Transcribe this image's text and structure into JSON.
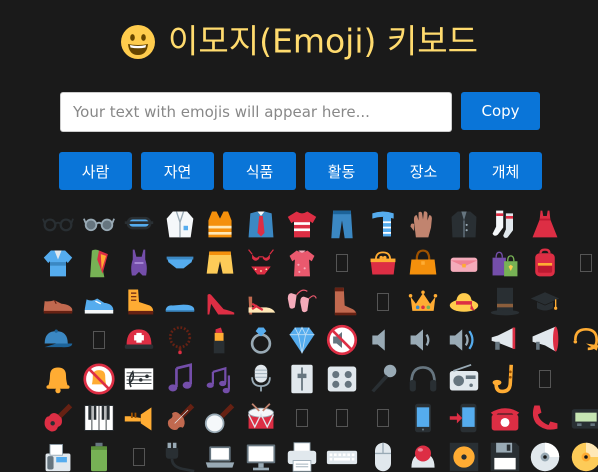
{
  "header": {
    "title": "이모지(Emoji) 키보드",
    "title_icon": "grinning-face-icon"
  },
  "input": {
    "placeholder": "Your text with emojis will appear here...",
    "value": ""
  },
  "copy_button": {
    "label": "Copy"
  },
  "categories": [
    {
      "label": "사람"
    },
    {
      "label": "자연"
    },
    {
      "label": "식품"
    },
    {
      "label": "활동"
    },
    {
      "label": "장소"
    },
    {
      "label": "개체"
    }
  ],
  "colors": {
    "background": "#1a1a1a",
    "title": "#ffdb6e",
    "button": "#0a75d8",
    "button_text": "#ffffff"
  },
  "emoji_rows": [
    [
      "glasses-icon",
      "sunglasses-icon",
      "goggles-icon",
      "lab-coat-icon",
      "safety-vest-icon",
      "necktie-icon",
      "t-shirt-icon",
      "jeans-icon",
      "scarf-icon",
      "gloves-icon",
      "coat-icon",
      "socks-icon",
      "dress-icon"
    ],
    [
      "kimono-icon",
      "sari-icon",
      "one-piece-swimsuit-icon",
      "briefs-icon",
      "shorts-icon",
      "bikini-icon",
      "womans-clothes-icon",
      "missing-glyph",
      "purse-icon",
      "handbag-icon",
      "clutch-bag-icon",
      "shopping-bags-icon",
      "backpack-icon",
      "missing-glyph"
    ],
    [
      "mans-shoe-icon",
      "running-shoe-icon",
      "hiking-boot-icon",
      "flat-shoe-icon",
      "high-heel-icon",
      "sandal-icon",
      "ballet-shoes-icon",
      "womans-boot-icon",
      "missing-glyph",
      "crown-icon",
      "womans-hat-icon",
      "top-hat-icon",
      "graduation-cap-icon"
    ],
    [
      "billed-cap-icon",
      "missing-glyph",
      "rescue-helmet-icon",
      "prayer-beads-icon",
      "lipstick-icon",
      "ring-icon",
      "gem-icon",
      "muted-speaker-icon",
      "speaker-low-icon",
      "speaker-medium-icon",
      "speaker-high-icon",
      "loudspeaker-icon",
      "megaphone-icon",
      "postal-horn-icon"
    ],
    [
      "bell-icon",
      "bell-slash-icon",
      "musical-score-icon",
      "musical-note-icon",
      "musical-notes-icon",
      "studio-microphone-icon",
      "level-slider-icon",
      "control-knobs-icon",
      "microphone-icon",
      "headphone-icon",
      "radio-icon",
      "saxophone-icon",
      "missing-glyph"
    ],
    [
      "guitar-icon",
      "musical-keyboard-icon",
      "trumpet-icon",
      "violin-icon",
      "banjo-icon",
      "drum-icon",
      "missing-glyph",
      "missing-glyph",
      "missing-glyph",
      "mobile-phone-icon",
      "mobile-phone-arrow-icon",
      "telephone-icon",
      "telephone-receiver-icon",
      "pager-icon"
    ],
    [
      "fax-machine-icon",
      "battery-icon",
      "missing-glyph",
      "electric-plug-icon",
      "laptop-icon",
      "desktop-computer-icon",
      "printer-icon",
      "keyboard-icon",
      "computer-mouse-icon",
      "trackball-icon",
      "computer-disk-icon",
      "floppy-disk-icon",
      "optical-disk-icon",
      "dvd-icon"
    ]
  ]
}
